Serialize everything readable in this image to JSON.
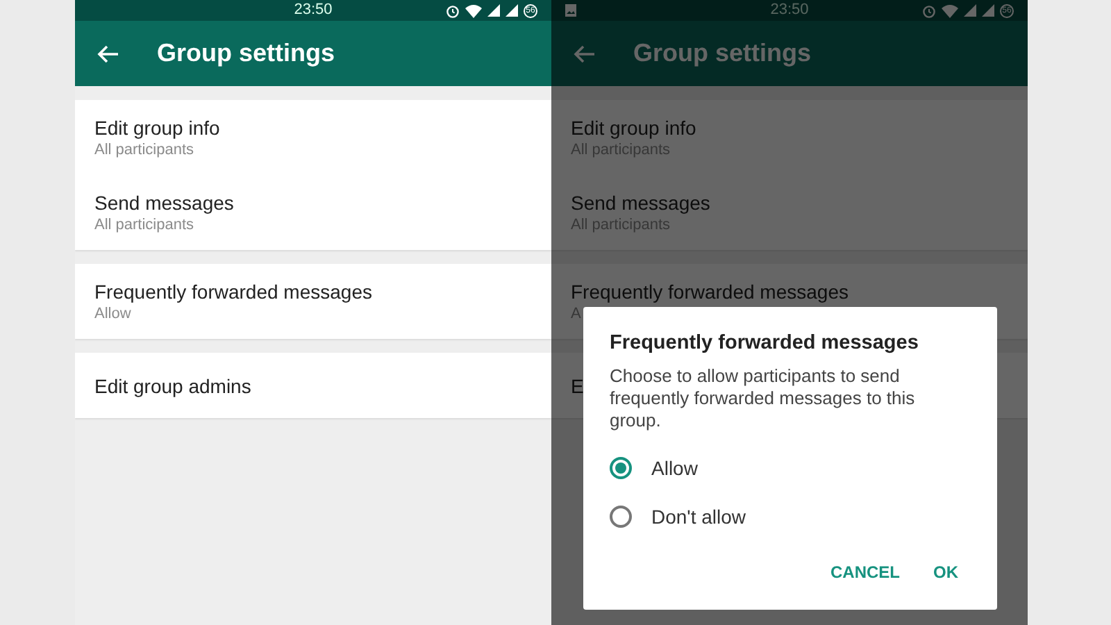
{
  "phones": [
    {
      "status": {
        "time": "23:50",
        "battery": "56",
        "notification": false
      },
      "title": "Group settings",
      "sections": [
        {
          "items": [
            {
              "title": "Edit group info",
              "subtitle": "All participants"
            },
            {
              "title": "Send messages",
              "subtitle": "All participants"
            }
          ]
        },
        {
          "items": [
            {
              "title": "Frequently forwarded messages",
              "subtitle": "Allow"
            }
          ]
        },
        {
          "items": [
            {
              "title": "Edit group admins"
            }
          ]
        }
      ]
    },
    {
      "status": {
        "time": "23:50",
        "battery": "56",
        "notification": true
      },
      "title": "Group settings",
      "sections": [
        {
          "items": [
            {
              "title": "Edit group info",
              "subtitle": "All participants"
            },
            {
              "title": "Send messages",
              "subtitle": "All participants"
            }
          ]
        },
        {
          "items": [
            {
              "title": "Frequently forwarded messages",
              "subtitle": "A"
            }
          ]
        },
        {
          "items": [
            {
              "title": "E"
            }
          ]
        }
      ],
      "dialog": {
        "title": "Frequently forwarded messages",
        "message": "Choose to allow participants to send frequently forwarded messages to this group.",
        "options": [
          {
            "label": "Allow",
            "selected": true
          },
          {
            "label": "Don't allow",
            "selected": false
          }
        ],
        "buttons": [
          "CANCEL",
          "OK"
        ]
      }
    }
  ]
}
